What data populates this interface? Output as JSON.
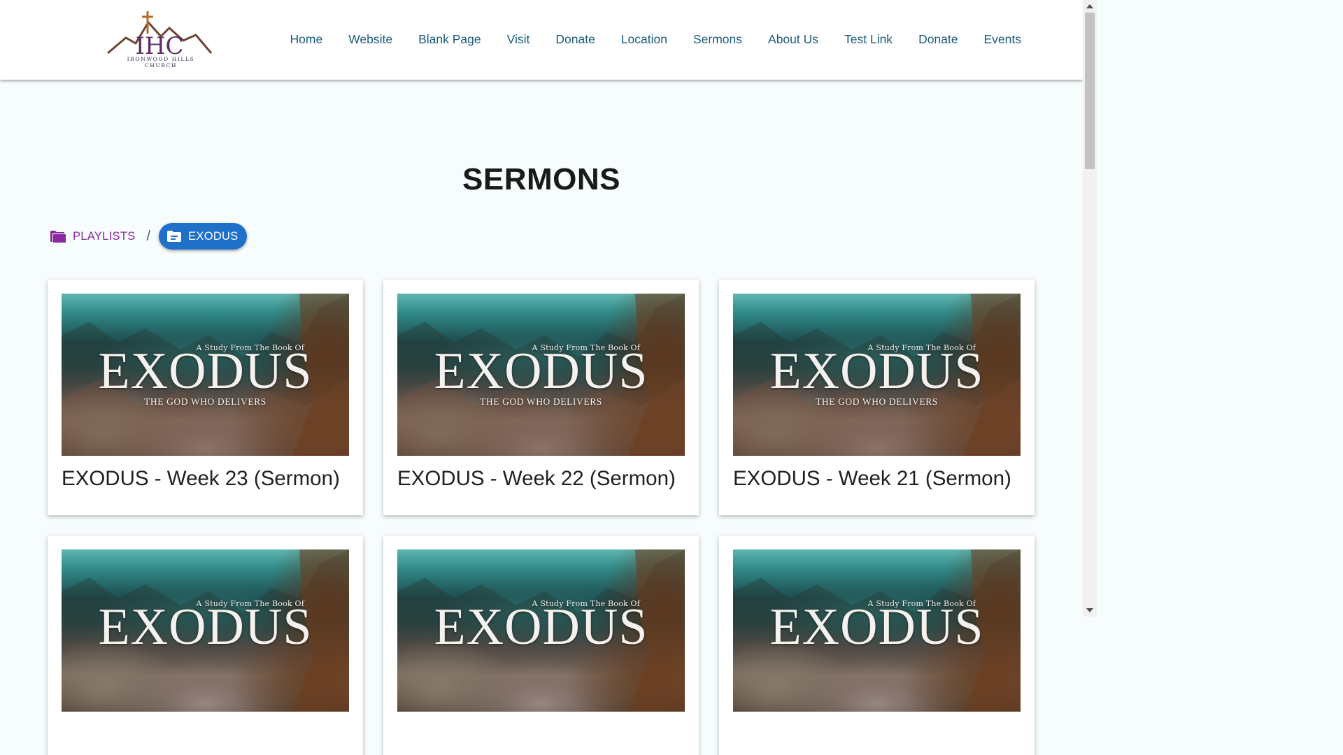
{
  "header": {
    "logo": {
      "monogram": "IHC",
      "name": "Ironwood Hills Church"
    },
    "nav": [
      "Home",
      "Website",
      "Blank Page",
      "Visit",
      "Donate",
      "Location",
      "Sermons",
      "About Us",
      "Test Link",
      "Donate",
      "Events"
    ]
  },
  "page": {
    "title": "SERMONS"
  },
  "breadcrumb": {
    "playlists_label": "PLAYLISTS",
    "separator": "/",
    "current_label": "EXODUS"
  },
  "thumbnail": {
    "study_line": "A Study From The Book Of",
    "series": "EXODUS",
    "tagline": "THE GOD WHO DELIVERS"
  },
  "sermons": [
    {
      "title": "EXODUS - Week 23 (Sermon)"
    },
    {
      "title": "EXODUS - Week 22 (Sermon)"
    },
    {
      "title": "EXODUS - Week 21 (Sermon)"
    },
    {
      "title": ""
    },
    {
      "title": ""
    },
    {
      "title": ""
    }
  ],
  "colors": {
    "nav_link": "#1b5a7e",
    "playlists": "#8a2aa0",
    "current_chip": "#1e70c9",
    "page_bg": "#f7fcfd"
  },
  "icons": {
    "playlists": "folder-icon",
    "current": "folder-open-list-icon",
    "scroll_up": "arrow-up-icon",
    "scroll_down": "arrow-down-icon"
  }
}
